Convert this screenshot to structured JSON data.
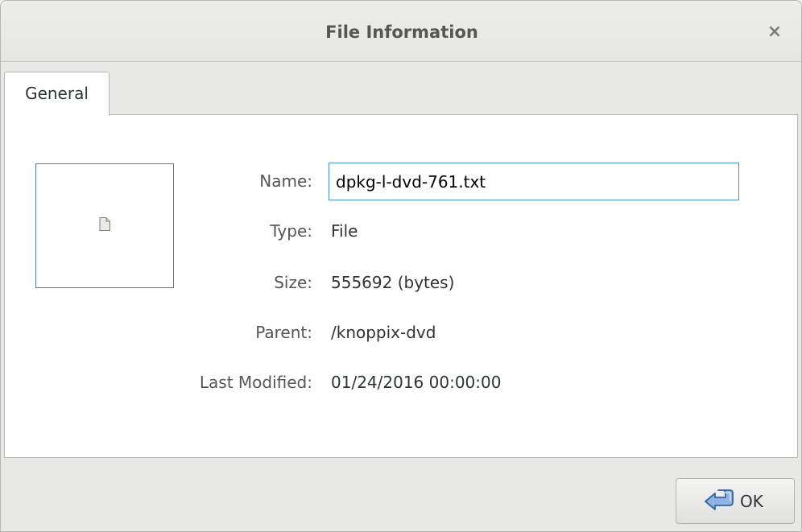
{
  "dialog": {
    "title": "File Information",
    "close_symbol": "×"
  },
  "tabs": [
    {
      "label": "General",
      "active": true
    }
  ],
  "preview": {
    "icon": "document-icon"
  },
  "fields": {
    "name": {
      "label": "Name:",
      "value": "dpkg-l-dvd-761.txt"
    },
    "type": {
      "label": "Type:",
      "value": "File"
    },
    "size": {
      "label": "Size:",
      "value": "555692 (bytes)"
    },
    "parent": {
      "label": "Parent:",
      "value": "/knoppix-dvd"
    },
    "modified": {
      "label": "Last Modified:",
      "value": "01/24/2016 00:00:00"
    }
  },
  "buttons": {
    "ok": {
      "label": "OK",
      "icon": "enter-arrow-icon"
    }
  },
  "colors": {
    "accent": "#4a90d9",
    "preview_border": "#4a7ab0",
    "icon_blue": "#3465a4"
  }
}
